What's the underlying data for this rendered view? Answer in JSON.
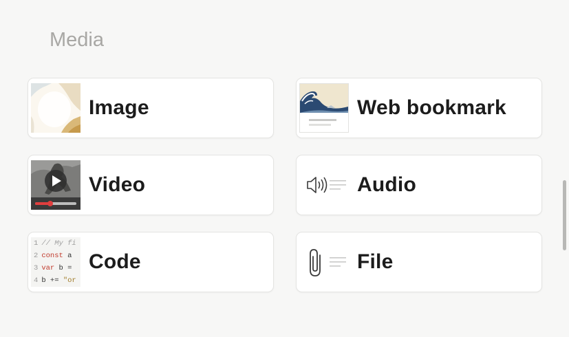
{
  "section": {
    "title": "Media"
  },
  "items": [
    {
      "label": "Image",
      "icon": "image-thumbnail"
    },
    {
      "label": "Web bookmark",
      "icon": "web-bookmark-thumbnail"
    },
    {
      "label": "Video",
      "icon": "video-thumbnail"
    },
    {
      "label": "Audio",
      "icon": "audio-icon"
    },
    {
      "label": "Code",
      "icon": "code-thumbnail"
    },
    {
      "label": "File",
      "icon": "paperclip-icon"
    }
  ],
  "code_preview": {
    "lines": [
      {
        "num": "1",
        "text": "// My fi"
      },
      {
        "num": "2",
        "kw": "const",
        "text": " a"
      },
      {
        "num": "3",
        "kw": "var",
        "text": " b ="
      },
      {
        "num": "4",
        "text": "b += ",
        "str": "\"or"
      }
    ]
  },
  "colors": {
    "background": "#f7f7f6",
    "card": "#ffffff",
    "section_title": "#a8a7a4",
    "video_progress": "#e03e3e",
    "code_keyword": "#c0392b"
  }
}
